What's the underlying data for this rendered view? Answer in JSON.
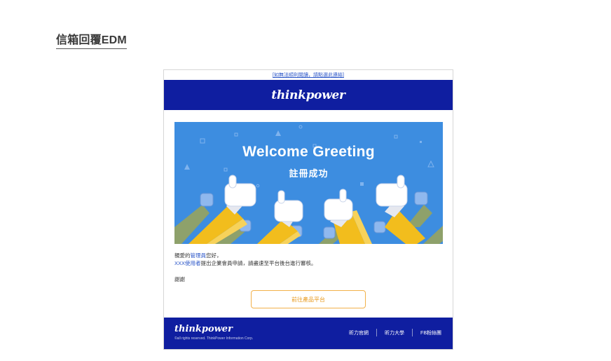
{
  "section": {
    "title": "信箱回覆EDM"
  },
  "email": {
    "top_link": "[如無法順利閱讀，請點選此連結]",
    "brand_logo": "thinkpower",
    "banner": {
      "title": "Welcome Greeting",
      "subtitle": "註冊成功"
    },
    "body": {
      "greeting_prefix": "親愛的",
      "role": "管理員",
      "greeting_suffix": "您好，",
      "user": "XXX使用者",
      "message": "提出企業會員申請，請盡速至平台後台進行審核。",
      "thanks": "謝謝"
    },
    "cta_label": "前往產品平台",
    "footer": {
      "logo": "thinkpower",
      "copyright": "©all rights reserved. ThinkPower Information Corp.",
      "links": [
        "昕力官網",
        "昕力大學",
        "FB粉絲團"
      ]
    }
  },
  "colors": {
    "header_blue": "#0f1ea0",
    "banner_blue": "#3d8de0",
    "accent_orange": "#e89a1e",
    "link_blue": "#2a55c8"
  }
}
